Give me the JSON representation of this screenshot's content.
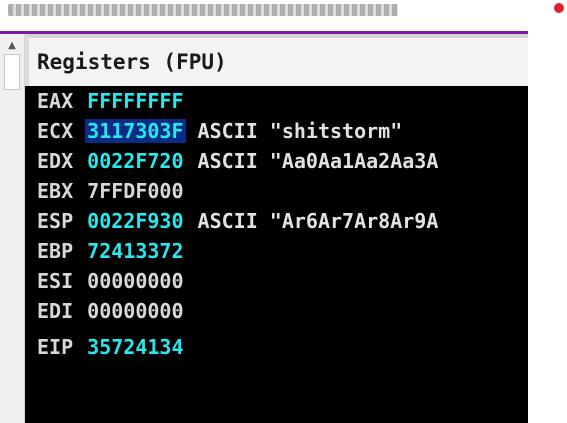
{
  "panel": {
    "title": "Registers (FPU)"
  },
  "scrollbar": {
    "up_arrow": "▲"
  },
  "registers": [
    {
      "name": "EAX",
      "value": "FFFFFFFF",
      "comment": ""
    },
    {
      "name": "ECX",
      "value": "3117303F",
      "comment": "ASCII \"shitstorm\""
    },
    {
      "name": "EDX",
      "value": "0022F720",
      "comment": "ASCII \"Aa0Aa1Aa2Aa3A"
    },
    {
      "name": "EBX",
      "value": "7FFDF000",
      "comment": ""
    },
    {
      "name": "ESP",
      "value": "0022F930",
      "comment": "ASCII \"Ar6Ar7Ar8Ar9A"
    },
    {
      "name": "EBP",
      "value": "72413372",
      "comment": ""
    },
    {
      "name": "ESI",
      "value": "00000000",
      "comment": ""
    },
    {
      "name": "EDI",
      "value": "00000000",
      "comment": ""
    },
    {
      "name": "EIP",
      "value": "35724134",
      "comment": ""
    }
  ],
  "colors": {
    "changed_value": "#27e8ee",
    "normal_value": "#d8d8d8",
    "selection": "#0a2c86",
    "background": "#000000",
    "window_accent": "#7a1aa6",
    "indicator": "#e0202a"
  }
}
